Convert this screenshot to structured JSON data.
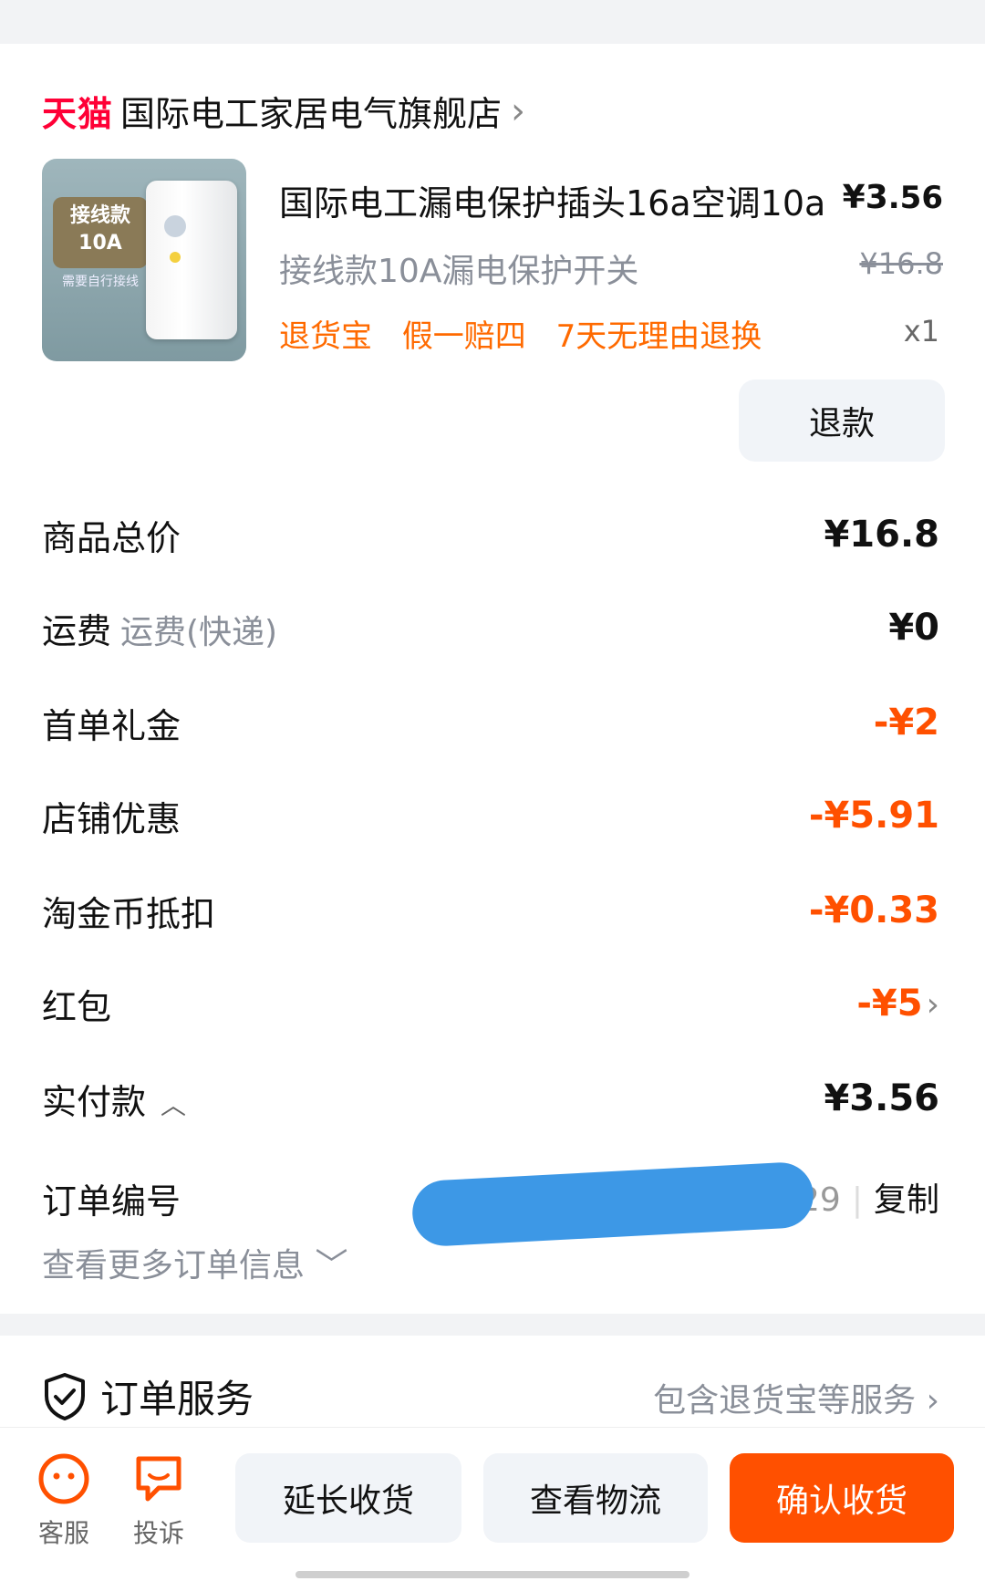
{
  "store": {
    "brand": "天猫",
    "name": "国际电工家居电气旗舰店"
  },
  "product": {
    "thumb_tag_line1": "接线款",
    "thumb_tag_line2": "10A",
    "thumb_sub": "需要自行接线",
    "title": "国际电工漏电保护插头16a空调10a",
    "price_symbol": "¥",
    "price_int": "3",
    "price_dec": ".56",
    "sku": "接线款10A漏电保护开关",
    "orig_price": "¥16.8",
    "tags": [
      "退货宝",
      "假一赔四",
      "7天无理由退换"
    ],
    "qty": "x1",
    "refund_label": "退款"
  },
  "fees": {
    "total_label": "商品总价",
    "total_value": "¥16.8",
    "shipping_label": "运费",
    "shipping_note": "运费(快递)",
    "shipping_value": "¥0",
    "first_label": "首单礼金",
    "first_value": "-¥2",
    "shop_label": "店铺优惠",
    "shop_value": "-¥5.91",
    "coin_label": "淘金币抵扣",
    "coin_value": "-¥0.33",
    "redpacket_label": "红包",
    "redpacket_value": "-¥5",
    "paid_label": "实付款",
    "paid_value": "¥3.56"
  },
  "order": {
    "number_label": "订单编号",
    "number_tail": "29",
    "copy_label": "复制",
    "more_label": "查看更多订单信息"
  },
  "service": {
    "title": "订单服务",
    "right_label": "包含退货宝等服务"
  },
  "bottom": {
    "customer_service": "客服",
    "complaint": "投诉",
    "extend": "延长收货",
    "logistics": "查看物流",
    "confirm": "确认收货"
  },
  "colors": {
    "accent": "#ff5000",
    "tmall": "#ff0036",
    "redact": "#3d98e6"
  }
}
